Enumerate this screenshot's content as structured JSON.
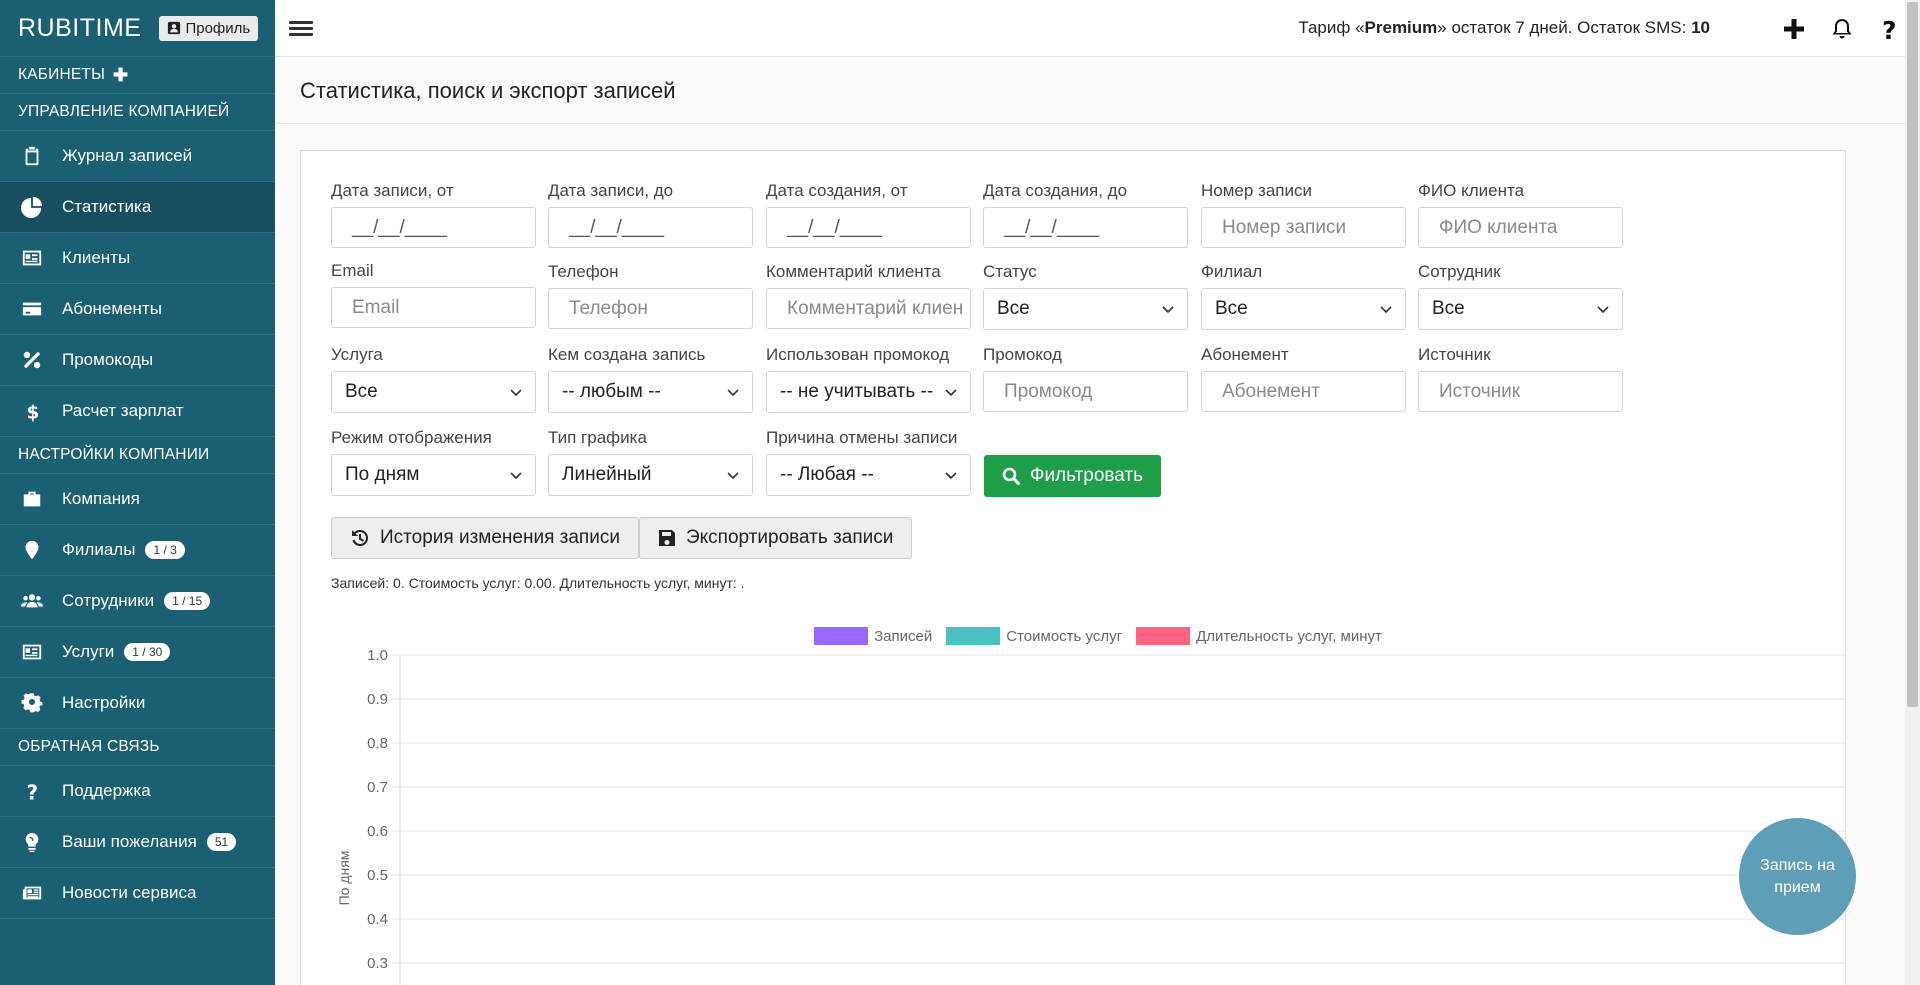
{
  "sidebar": {
    "brand": "RUBITIME",
    "profile_label": "Профиль",
    "cabinets_label": "КАБИНЕТЫ",
    "sections": {
      "manage": "УПРАВЛЕНИЕ КОМПАНИЕЙ",
      "settings": "НАСТРОЙКИ КОМПАНИИ",
      "feedback": "ОБРАТНАЯ СВЯЗЬ"
    },
    "manage_items": [
      {
        "label": "Журнал записей",
        "icon": "clipboard-icon"
      },
      {
        "label": "Статистика",
        "icon": "pie-chart-icon"
      },
      {
        "label": "Клиенты",
        "icon": "id-card-icon"
      },
      {
        "label": "Абонементы",
        "icon": "credit-card-icon"
      },
      {
        "label": "Промокоды",
        "icon": "percent-icon"
      },
      {
        "label": "Расчет зарплат",
        "icon": "dollar-icon"
      }
    ],
    "settings_items": [
      {
        "label": "Компания",
        "icon": "briefcase-icon",
        "badge": ""
      },
      {
        "label": "Филиалы",
        "icon": "map-pin-icon",
        "badge": "1 / 3"
      },
      {
        "label": "Сотрудники",
        "icon": "users-icon",
        "badge": "1 / 15"
      },
      {
        "label": "Услуги",
        "icon": "id-card-icon",
        "badge": "1 / 30"
      },
      {
        "label": "Настройки",
        "icon": "gear-icon",
        "badge": ""
      }
    ],
    "feedback_items": [
      {
        "label": "Поддержка",
        "icon": "question-icon",
        "badge": ""
      },
      {
        "label": "Ваши пожелания",
        "icon": "lightbulb-icon",
        "badge": "51"
      },
      {
        "label": "Новости сервиса",
        "icon": "newspaper-icon",
        "badge": ""
      }
    ]
  },
  "topbar": {
    "tariff_prefix": "Тариф «",
    "tariff_name": "Premium",
    "tariff_suffix": "» остаток 7 дней. Остаток SMS: ",
    "sms_count": "10"
  },
  "page": {
    "title": "Статистика, поиск и экспорт записей"
  },
  "filters": {
    "date_from": {
      "label": "Дата записи, от",
      "value": "__/__/____"
    },
    "date_to": {
      "label": "Дата записи, до",
      "value": "__/__/____"
    },
    "created_from": {
      "label": "Дата создания, от",
      "value": "__/__/____"
    },
    "created_to": {
      "label": "Дата создания, до",
      "value": "__/__/____"
    },
    "record_number": {
      "label": "Номер записи",
      "placeholder": "Номер записи"
    },
    "client_name": {
      "label": "ФИО клиента",
      "placeholder": "ФИО клиента"
    },
    "email": {
      "label": "Email",
      "placeholder": "Email"
    },
    "phone": {
      "label": "Телефон",
      "placeholder": "Телефон"
    },
    "comment": {
      "label": "Комментарий клиента",
      "placeholder": "Комментарий клиен"
    },
    "status": {
      "label": "Статус",
      "value": "Все"
    },
    "branch": {
      "label": "Филиал",
      "value": "Все"
    },
    "employee": {
      "label": "Сотрудник",
      "value": "Все"
    },
    "service": {
      "label": "Услуга",
      "value": "Все"
    },
    "created_by": {
      "label": "Кем создана запись",
      "value": "-- любым --"
    },
    "promo_used": {
      "label": "Использован промокод",
      "value": "-- не учитывать --"
    },
    "promo": {
      "label": "Промокод",
      "placeholder": "Промокод"
    },
    "subscription": {
      "label": "Абонемент",
      "placeholder": "Абонемент"
    },
    "source": {
      "label": "Источник",
      "placeholder": "Источник"
    },
    "display_mode": {
      "label": "Режим отображения",
      "value": "По дням"
    },
    "chart_type": {
      "label": "Тип графика",
      "value": "Линейный"
    },
    "cancel_reason": {
      "label": "Причина отмены записи",
      "value": "-- Любая --"
    },
    "filter_button": "Фильтровать",
    "history_button": "История изменения записи",
    "export_button": "Экспортировать записи"
  },
  "summary": "Записей: 0. Стоимость услуг: 0.00. Длительность услуг, минут: .",
  "fab_label": "Запись на прием",
  "chart_data": {
    "type": "line",
    "series": [
      {
        "name": "Записей",
        "color": "#9966ff",
        "values": []
      },
      {
        "name": "Стоимость услуг",
        "color": "#4bc0c0",
        "values": []
      },
      {
        "name": "Длительность услуг, минут",
        "color": "#ff6384",
        "values": []
      }
    ],
    "ylabel": "По дням",
    "yticks": [
      "1.0",
      "0.9",
      "0.8",
      "0.7",
      "0.6",
      "0.5",
      "0.4",
      "0.3"
    ],
    "ylim": [
      0.3,
      1.0
    ],
    "grid": true,
    "legend": "top-center"
  }
}
